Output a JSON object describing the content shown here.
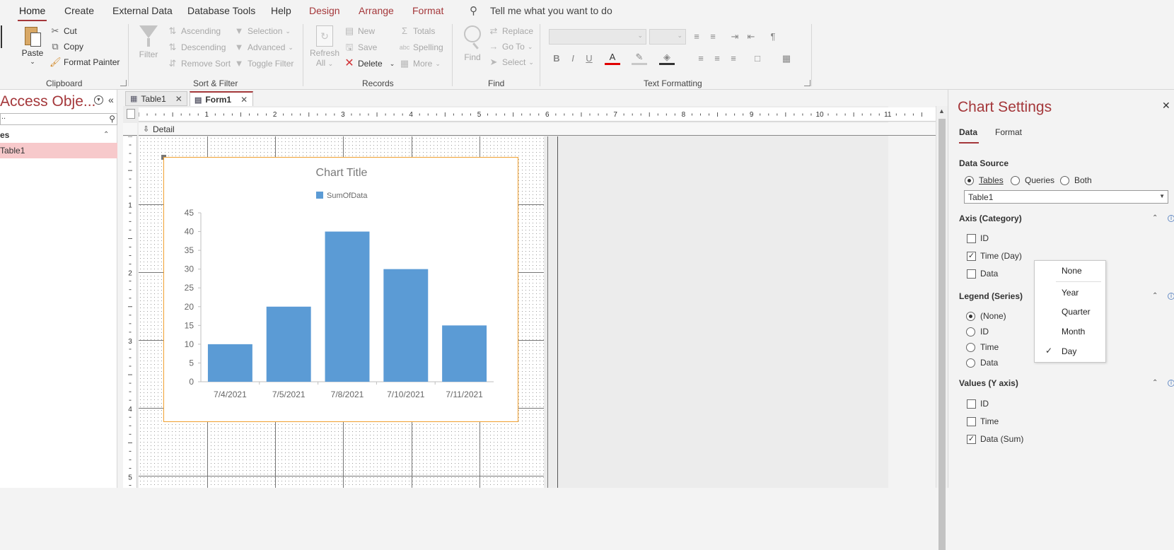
{
  "menu": {
    "tabs": [
      "Home",
      "Create",
      "External Data",
      "Database Tools",
      "Help",
      "Design",
      "Arrange",
      "Format"
    ],
    "tell_me": "Tell me what you want to do"
  },
  "ribbon": {
    "clipboard": {
      "label": "Clipboard",
      "paste": "Paste",
      "cut": "Cut",
      "copy": "Copy",
      "format_painter": "Format Painter"
    },
    "sort_filter": {
      "label": "Sort & Filter",
      "filter": "Filter",
      "ascending": "Ascending",
      "descending": "Descending",
      "remove_sort": "Remove Sort",
      "selection": "Selection",
      "advanced": "Advanced",
      "toggle_filter": "Toggle Filter"
    },
    "records": {
      "label": "Records",
      "refresh": "Refresh",
      "refresh_all": "All",
      "new": "New",
      "save": "Save",
      "delete": "Delete",
      "totals": "Totals",
      "spelling": "Spelling",
      "more": "More"
    },
    "find": {
      "label": "Find",
      "find": "Find",
      "replace": "Replace",
      "go_to": "Go To",
      "select": "Select"
    },
    "text_formatting": {
      "label": "Text Formatting"
    }
  },
  "nav": {
    "title": "Access Obje...",
    "section": "es",
    "item": "Table1"
  },
  "doc_tabs": [
    "Table1",
    "Form1"
  ],
  "design": {
    "detail_label": "Detail",
    "ruler_numbers": [
      "1",
      "2",
      "3",
      "4",
      "5",
      "6",
      "7",
      "8",
      "9",
      "10",
      "11"
    ],
    "vruler_numbers": [
      "1",
      "2",
      "3",
      "4",
      "5"
    ]
  },
  "chart_data": {
    "type": "bar",
    "title": "Chart Title",
    "legend": [
      "SumOfData"
    ],
    "categories": [
      "7/4/2021",
      "7/5/2021",
      "7/8/2021",
      "7/10/2021",
      "7/11/2021"
    ],
    "series": [
      {
        "name": "SumOfData",
        "values": [
          10,
          20,
          40,
          30,
          15
        ]
      }
    ],
    "ylim": [
      0,
      45
    ],
    "yticks": [
      0,
      5,
      10,
      15,
      20,
      25,
      30,
      35,
      40,
      45
    ],
    "color": "#5b9bd5",
    "legend_position": "top"
  },
  "pane": {
    "title": "Chart Settings",
    "tabs": [
      "Data",
      "Format"
    ],
    "data_source": {
      "label": "Data Source",
      "options": [
        "Tables",
        "Queries",
        "Both"
      ],
      "selected": "Tables",
      "table": "Table1"
    },
    "axis": {
      "label": "Axis (Category)",
      "items": [
        {
          "label": "ID",
          "checked": false
        },
        {
          "label": "Time (Day)",
          "checked": true
        },
        {
          "label": "Data",
          "checked": false
        }
      ]
    },
    "legend": {
      "label": "Legend (Series)",
      "items": [
        "(None)",
        "ID",
        "Time",
        "Data"
      ],
      "selected": "(None)"
    },
    "values": {
      "label": "Values (Y axis)",
      "items": [
        {
          "label": "ID",
          "checked": false
        },
        {
          "label": "Time",
          "checked": false
        },
        {
          "label": "Data (Sum)",
          "checked": true
        }
      ]
    }
  },
  "popup": {
    "items": [
      "None",
      "Year",
      "Quarter",
      "Month",
      "Day"
    ],
    "checked": "Day"
  },
  "colors": {
    "accent": "#a4373a",
    "chart_border": "#f0a030",
    "bar": "#5b9bd5"
  }
}
